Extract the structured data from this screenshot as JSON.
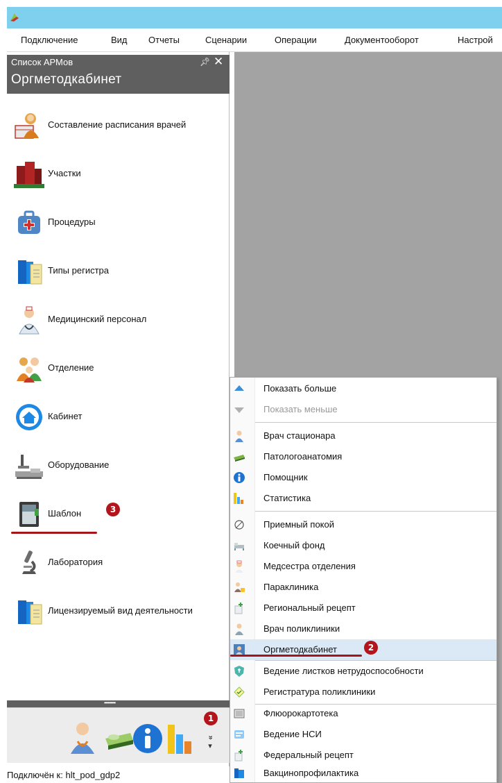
{
  "window": {
    "app_icon": "app-logo-icon"
  },
  "menubar": {
    "items": [
      "Подключение",
      "Вид",
      "Отчеты",
      "Сценарии",
      "Операции",
      "Документооборот",
      "Настрой"
    ]
  },
  "panel": {
    "caption": "Список АРМов",
    "pin_icon": "pin-icon",
    "close_icon": "close-icon",
    "title": "Оргметодкабинет",
    "items": [
      {
        "label": "Составление расписания врачей",
        "icon": "doctor-schedule-icon"
      },
      {
        "label": "Участки",
        "icon": "buildings-icon"
      },
      {
        "label": "Процедуры",
        "icon": "first-aid-kit-icon"
      },
      {
        "label": "Типы регистра",
        "icon": "binders-icon"
      },
      {
        "label": "Медицинский персонал",
        "icon": "medical-staff-icon"
      },
      {
        "label": "Отделение",
        "icon": "people-group-icon"
      },
      {
        "label": "Кабинет",
        "icon": "home-icon"
      },
      {
        "label": "Оборудование",
        "icon": "microscope-equipment-icon"
      },
      {
        "label": "Шаблон",
        "icon": "template-book-icon"
      },
      {
        "label": "Лаборатория",
        "icon": "microscope-icon"
      },
      {
        "label": "Лицензируемый вид деятельности",
        "icon": "binders-icon"
      }
    ]
  },
  "annotations": {
    "one": "1",
    "two": "2",
    "three": "3"
  },
  "quickbar": {
    "icons": [
      "doctor-icon",
      "pathology-bed-icon",
      "info-icon",
      "statistics-chart-icon"
    ],
    "more_icon": "chevron-double-down-icon",
    "more_label": "»"
  },
  "status": {
    "text": "Подключён к: hlt_pod_gdp2"
  },
  "dropdown": {
    "items": [
      {
        "label": "Показать больше",
        "icon": "arrow-up-icon",
        "disabled": false
      },
      {
        "label": "Показать меньше",
        "icon": "arrow-down-icon",
        "disabled": true
      },
      {
        "label": "Врач стационара",
        "icon": "doctor-icon"
      },
      {
        "label": "Патологоанатомия",
        "icon": "pathology-bed-icon"
      },
      {
        "label": "Помощник",
        "icon": "info-icon"
      },
      {
        "label": "Статистика",
        "icon": "statistics-chart-icon"
      },
      {
        "label": "Приемный покой",
        "icon": "reception-icon"
      },
      {
        "label": "Коечный фонд",
        "icon": "bed-icon"
      },
      {
        "label": "Медсестра отделения",
        "icon": "nurse-icon"
      },
      {
        "label": "Параклиника",
        "icon": "paraclinic-icon"
      },
      {
        "label": "Региональный рецепт",
        "icon": "regional-recipe-icon"
      },
      {
        "label": "Врач поликлиники",
        "icon": "polyclinic-doctor-icon"
      },
      {
        "label": "Оргметодкабинет",
        "icon": "orgmethod-icon"
      },
      {
        "label": "Ведение листков нетрудоспособности",
        "icon": "sick-leave-icon"
      },
      {
        "label": "Регистратура поликлиники",
        "icon": "registry-icon"
      },
      {
        "label": "Флюорокартотека",
        "icon": "fluoro-file-icon"
      },
      {
        "label": "Ведение НСИ",
        "icon": "nsi-icon"
      },
      {
        "label": "Федеральный рецепт",
        "icon": "federal-recipe-icon"
      },
      {
        "label": "Вакцинопрофилактика",
        "icon": "vaccine-icon"
      }
    ]
  },
  "colors": {
    "titlebar": "#7fd0ef",
    "panel_header": "#5f5f5f",
    "workspace": "#a3a3a3",
    "annotation_red": "#b2161c",
    "highlight": "#dbe8f5"
  }
}
